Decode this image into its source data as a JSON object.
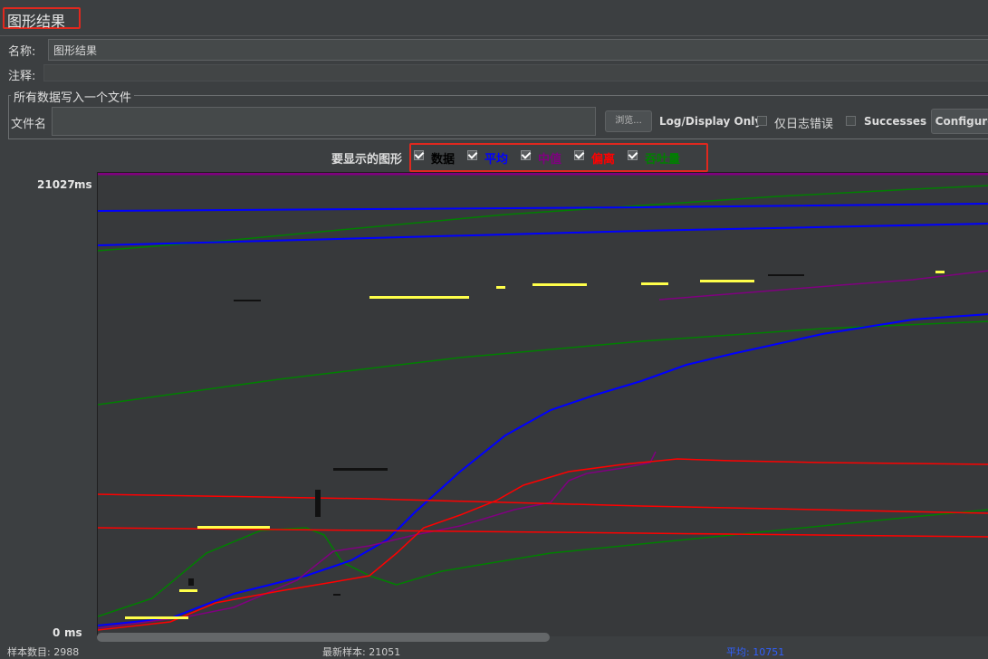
{
  "window": {
    "title": "图形结果"
  },
  "form": {
    "name_label": "名称:",
    "name_value": "图形结果",
    "comment_label": "注释:",
    "comment_value": ""
  },
  "file_panel": {
    "legend": "所有数据写入一个文件",
    "filename_label": "文件名",
    "filename_value": "",
    "browse_label": "浏览...",
    "log_display_label": "Log/Display Only:",
    "errors_label": "仅日志错误",
    "errors_checked": false,
    "successes_label": "Successes",
    "successes_checked": false,
    "configure_label": "Configure"
  },
  "graph_options": {
    "label": "要显示的图形",
    "items": [
      {
        "label": "数据",
        "checked": true,
        "color": "#000000"
      },
      {
        "label": "平均",
        "checked": true,
        "color": "#0000ff"
      },
      {
        "label": "中值",
        "checked": true,
        "color": "#800080"
      },
      {
        "label": "偏离",
        "checked": true,
        "color": "#ff0000"
      },
      {
        "label": "吞吐量",
        "checked": true,
        "color": "#008000"
      }
    ]
  },
  "chart_data": {
    "type": "line",
    "y_max_label": "21027",
    "y_min_label": "0",
    "y_unit": "ms",
    "ylim": [
      0,
      21027
    ],
    "series": [
      {
        "name": "数据",
        "color": "#000000"
      },
      {
        "name": "平均",
        "color": "#0000ff"
      },
      {
        "name": "中值",
        "color": "#800080"
      },
      {
        "name": "偏离",
        "color": "#ff0000"
      },
      {
        "name": "吞吐量",
        "color": "#008000"
      }
    ]
  },
  "bottom": {
    "samples_label": "样本数目: 2988",
    "latest_label": "最新样本: 21051",
    "average_label": "平均: 10751"
  }
}
